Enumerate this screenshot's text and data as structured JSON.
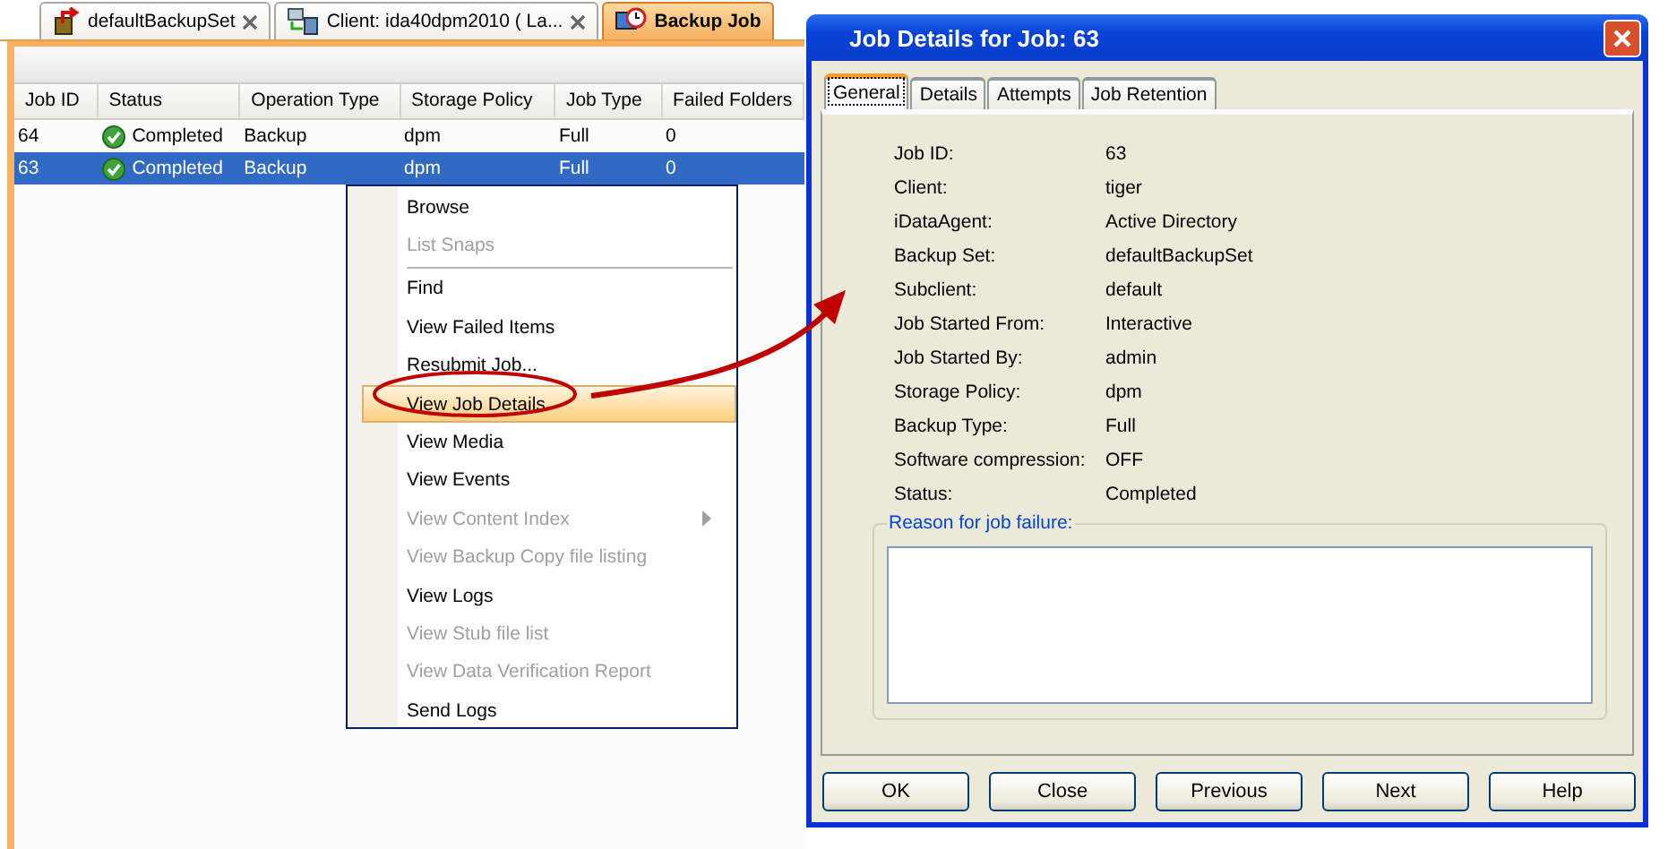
{
  "tabs": [
    {
      "label": "defaultBackupSet",
      "kind": "backupset",
      "selected": false,
      "closable": true
    },
    {
      "label": "Client: ida40dpm2010 ( La...",
      "kind": "client",
      "selected": false,
      "closable": true
    },
    {
      "label": "Backup Job",
      "kind": "jobs",
      "selected": true,
      "closable": false
    }
  ],
  "table": {
    "columns": [
      "Job ID",
      "Status",
      "Operation Type",
      "Storage Policy",
      "Job Type",
      "Failed Folders"
    ],
    "rows": [
      {
        "cells": [
          "64",
          "Completed",
          "Backup",
          "dpm",
          "Full",
          "0"
        ],
        "selected": false
      },
      {
        "cells": [
          "63",
          "Completed",
          "Backup",
          "dpm",
          "Full",
          "0"
        ],
        "selected": true
      }
    ]
  },
  "menu": {
    "items": [
      {
        "kind": "item",
        "label": "Browse",
        "disabled": false,
        "selected": false,
        "submenu": false
      },
      {
        "kind": "item",
        "label": "List Snaps",
        "disabled": true,
        "selected": false,
        "submenu": false
      },
      {
        "kind": "separator"
      },
      {
        "kind": "item",
        "label": "Find",
        "disabled": false,
        "selected": false,
        "submenu": false
      },
      {
        "kind": "item",
        "label": "View Failed Items",
        "disabled": false,
        "selected": false,
        "submenu": false
      },
      {
        "kind": "item",
        "label": "Resubmit Job...",
        "disabled": false,
        "selected": false,
        "submenu": false
      },
      {
        "kind": "item",
        "label": "View Job Details",
        "disabled": false,
        "selected": true,
        "submenu": false
      },
      {
        "kind": "item",
        "label": "View Media",
        "disabled": false,
        "selected": false,
        "submenu": false
      },
      {
        "kind": "item",
        "label": "View Events",
        "disabled": false,
        "selected": false,
        "submenu": false
      },
      {
        "kind": "item",
        "label": "View Content Index",
        "disabled": true,
        "selected": false,
        "submenu": true
      },
      {
        "kind": "item",
        "label": "View Backup Copy file listing",
        "disabled": true,
        "selected": false,
        "submenu": false
      },
      {
        "kind": "item",
        "label": "View Logs",
        "disabled": false,
        "selected": false,
        "submenu": false
      },
      {
        "kind": "item",
        "label": "View Stub file list",
        "disabled": true,
        "selected": false,
        "submenu": false
      },
      {
        "kind": "item",
        "label": "View Data Verification Report",
        "disabled": true,
        "selected": false,
        "submenu": false
      },
      {
        "kind": "item",
        "label": "Send Logs",
        "disabled": false,
        "selected": false,
        "submenu": false
      }
    ]
  },
  "dialog": {
    "title": "Job Details for Job: 63",
    "tabs": [
      {
        "label": "General",
        "selected": true
      },
      {
        "label": "Details",
        "selected": false
      },
      {
        "label": "Attempts",
        "selected": false
      },
      {
        "label": "Job Retention",
        "selected": false
      }
    ],
    "fields": [
      {
        "label": "Job ID:",
        "value": "63"
      },
      {
        "label": "Client:",
        "value": "tiger"
      },
      {
        "label": "iDataAgent:",
        "value": "Active Directory"
      },
      {
        "label": "Backup Set:",
        "value": "defaultBackupSet"
      },
      {
        "label": "Subclient:",
        "value": "default"
      },
      {
        "label": "Job Started From:",
        "value": "Interactive"
      },
      {
        "label": "Job Started By:",
        "value": "admin"
      },
      {
        "label": "Storage Policy:",
        "value": "dpm"
      },
      {
        "label": "Backup Type:",
        "value": "Full"
      },
      {
        "label": "Software compression:",
        "value": "OFF"
      },
      {
        "label": "Status:",
        "value": "Completed"
      }
    ],
    "reason_label": "Reason for job failure:",
    "buttons": [
      "OK",
      "Close",
      "Previous",
      "Next",
      "Help"
    ]
  }
}
